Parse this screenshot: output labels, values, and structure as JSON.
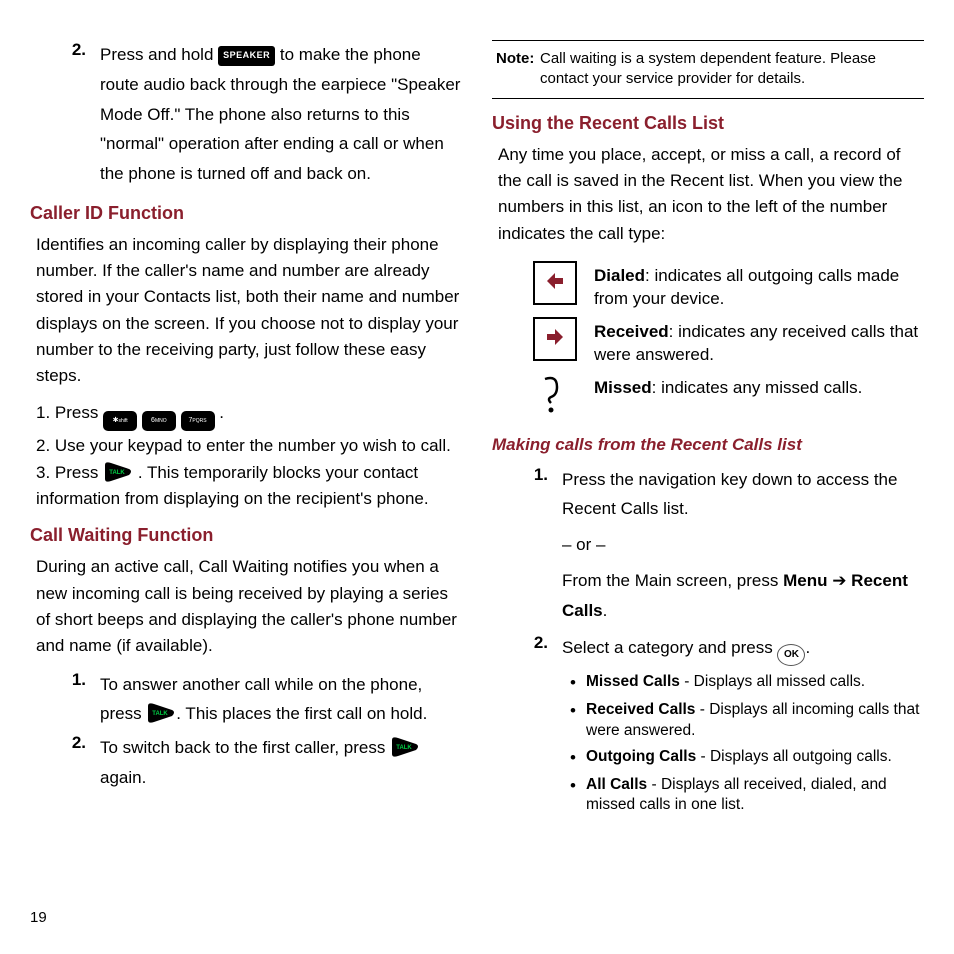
{
  "pageNumber": "19",
  "left": {
    "step2_num": "2.",
    "step2_text_a": "Press and hold ",
    "speaker_key": "SPEAKER",
    "step2_text_b": " to make the phone route audio back through the earpiece \"Speaker Mode Off.\" The phone also returns to this \"normal\" operation after ending a call or when the phone is turned off and back on.",
    "callerid_heading": "Caller ID Function",
    "callerid_body": "Identifies an incoming caller by displaying their phone number. If the caller's name and number are already stored in your Contacts list, both their name and number displays on the screen. If you choose not to display your number to the receiving party, just follow these easy steps.",
    "cid_step1_a": "1. Press ",
    "cid_step1_b": ".",
    "cid_step2": "2. Use your keypad to enter the number yo wish to call.",
    "cid_step3_a": "3. Press ",
    "cid_step3_b": ". This temporarily blocks your contact information from displaying on the recipient's phone.",
    "callwait_heading": "Call Waiting Function",
    "callwait_body": "During an active call, Call Waiting notifies you when a new incoming call is being received by playing a series of short beeps and displaying the caller's phone number and name (if available).",
    "cw1_num": "1.",
    "cw1_a": "To answer another call while on the phone, press ",
    "cw1_b": ". This places the first call on hold.",
    "cw2_num": "2.",
    "cw2_a": "To switch back to the first caller, press ",
    "cw2_b": " again."
  },
  "right": {
    "note_label": "Note:",
    "note_body": " Call waiting is a system dependent feature. Please contact your service provider for details.",
    "recent_heading": "Using the Recent Calls List",
    "recent_body": "Any time you place, accept, or miss a call, a record of the call is saved in the Recent list. When you view the numbers in this list, an icon to the left of the number indicates the call type:",
    "dialed_label": "Dialed",
    "dialed_text": ": indicates all outgoing calls made from your device.",
    "received_label": "Received",
    "received_text": ": indicates any received calls that were answered.",
    "missed_label": "Missed",
    "missed_text": ": indicates any missed calls.",
    "making_heading": "Making calls from the Recent Calls list",
    "m1_num": "1.",
    "m1_a": "Press the navigation key down to access the Recent Calls list.",
    "m1_or": "– or –",
    "m1_b_a": "From the Main screen, press ",
    "m1_b_menu": "Menu",
    "m1_b_arrow": " ➔ ",
    "m1_b_recent": "Recent Calls",
    "m1_b_end": ".",
    "m2_num": "2.",
    "m2_a": "Select a category and press ",
    "m2_b": ".",
    "ok_label": "OK",
    "cat_missed_l": "Missed Calls",
    "cat_missed_t": " - Displays all missed calls.",
    "cat_recv_l": "Received Calls",
    "cat_recv_t": " - Displays all incoming calls that were answered.",
    "cat_out_l": "Outgoing Calls",
    "cat_out_t": " - Displays all outgoing calls.",
    "cat_all_l": "All Calls",
    "cat_all_t": " - Displays all received, dialed, and missed calls in one list."
  }
}
